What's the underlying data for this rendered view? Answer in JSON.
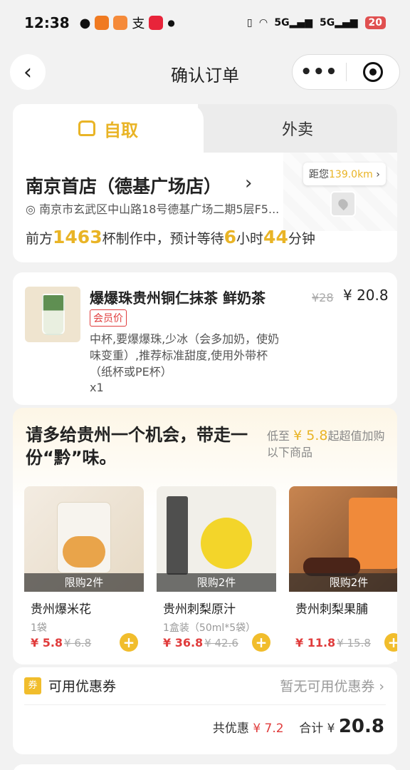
{
  "status_bar": {
    "time": "12:38",
    "network": "5G",
    "battery": "20",
    "app_icons": [
      "wechat-icon",
      "app-orange-icon",
      "app-orange2-icon",
      "alipay-icon",
      "xiaohongshu-icon"
    ]
  },
  "nav": {
    "title": "确认订单",
    "back": "‹",
    "more": "•••"
  },
  "order_type": {
    "tabs": [
      {
        "label": "自取",
        "selected": true
      },
      {
        "label": "外卖",
        "selected": false
      }
    ]
  },
  "store": {
    "name": "南京首店（德基广场店）",
    "address": "南京市玄武区中山路18号德基广场二期5层F5...",
    "distance_prefix": "距您",
    "distance": "139.0km",
    "queue_prefix": "前方",
    "queue_count": "1463",
    "queue_mid": "杯制作中，预计等待",
    "wait_hours": "6",
    "hours_unit": "小时",
    "wait_minutes": "44",
    "minutes_unit": "分钟"
  },
  "product": {
    "name": "爆爆珠贵州铜仁抹茶 鲜奶茶",
    "original_price": "¥28",
    "price": "¥ 20.8",
    "tag": "会员价",
    "spec": "中杯,要爆爆珠,少冰（会多加奶，使奶味变重）,推荐标准甜度,使用外带杯（纸杯或PE杯）",
    "quantity": "x1"
  },
  "promo": {
    "title": "请多给贵州一个机会，带走一份“黔”味。",
    "sub_prefix": "低至",
    "sub_price": "¥ 5.8",
    "sub_suffix": "起超值加购以下商品",
    "goods": [
      {
        "name": "贵州爆米花",
        "spec": "1袋",
        "price": "¥ 5.8",
        "old_price": "¥ 6.8",
        "limit": "限购2件",
        "add": "+"
      },
      {
        "name": "贵州刺梨原汁",
        "spec": "1盒装（50ml*5袋）",
        "price": "¥ 36.8",
        "old_price": "¥ 42.6",
        "limit": "限购2件",
        "add": "+"
      },
      {
        "name": "贵州刺梨果脯",
        "spec": "",
        "price": "¥ 11.8",
        "old_price": "¥ 15.8",
        "limit": "限购2件",
        "add": "+"
      }
    ]
  },
  "coupon": {
    "badge": "券",
    "label": "可用优惠券",
    "status": "暂无可用优惠券 ›"
  },
  "totals": {
    "discount_label": "共优惠",
    "discount": "¥ 7.2",
    "total_label": "合计",
    "currency": "¥",
    "total": "20.8"
  },
  "colors": {
    "accent": "#e9b426",
    "price_red": "#e03c3c",
    "background": "#f2f2f2"
  }
}
